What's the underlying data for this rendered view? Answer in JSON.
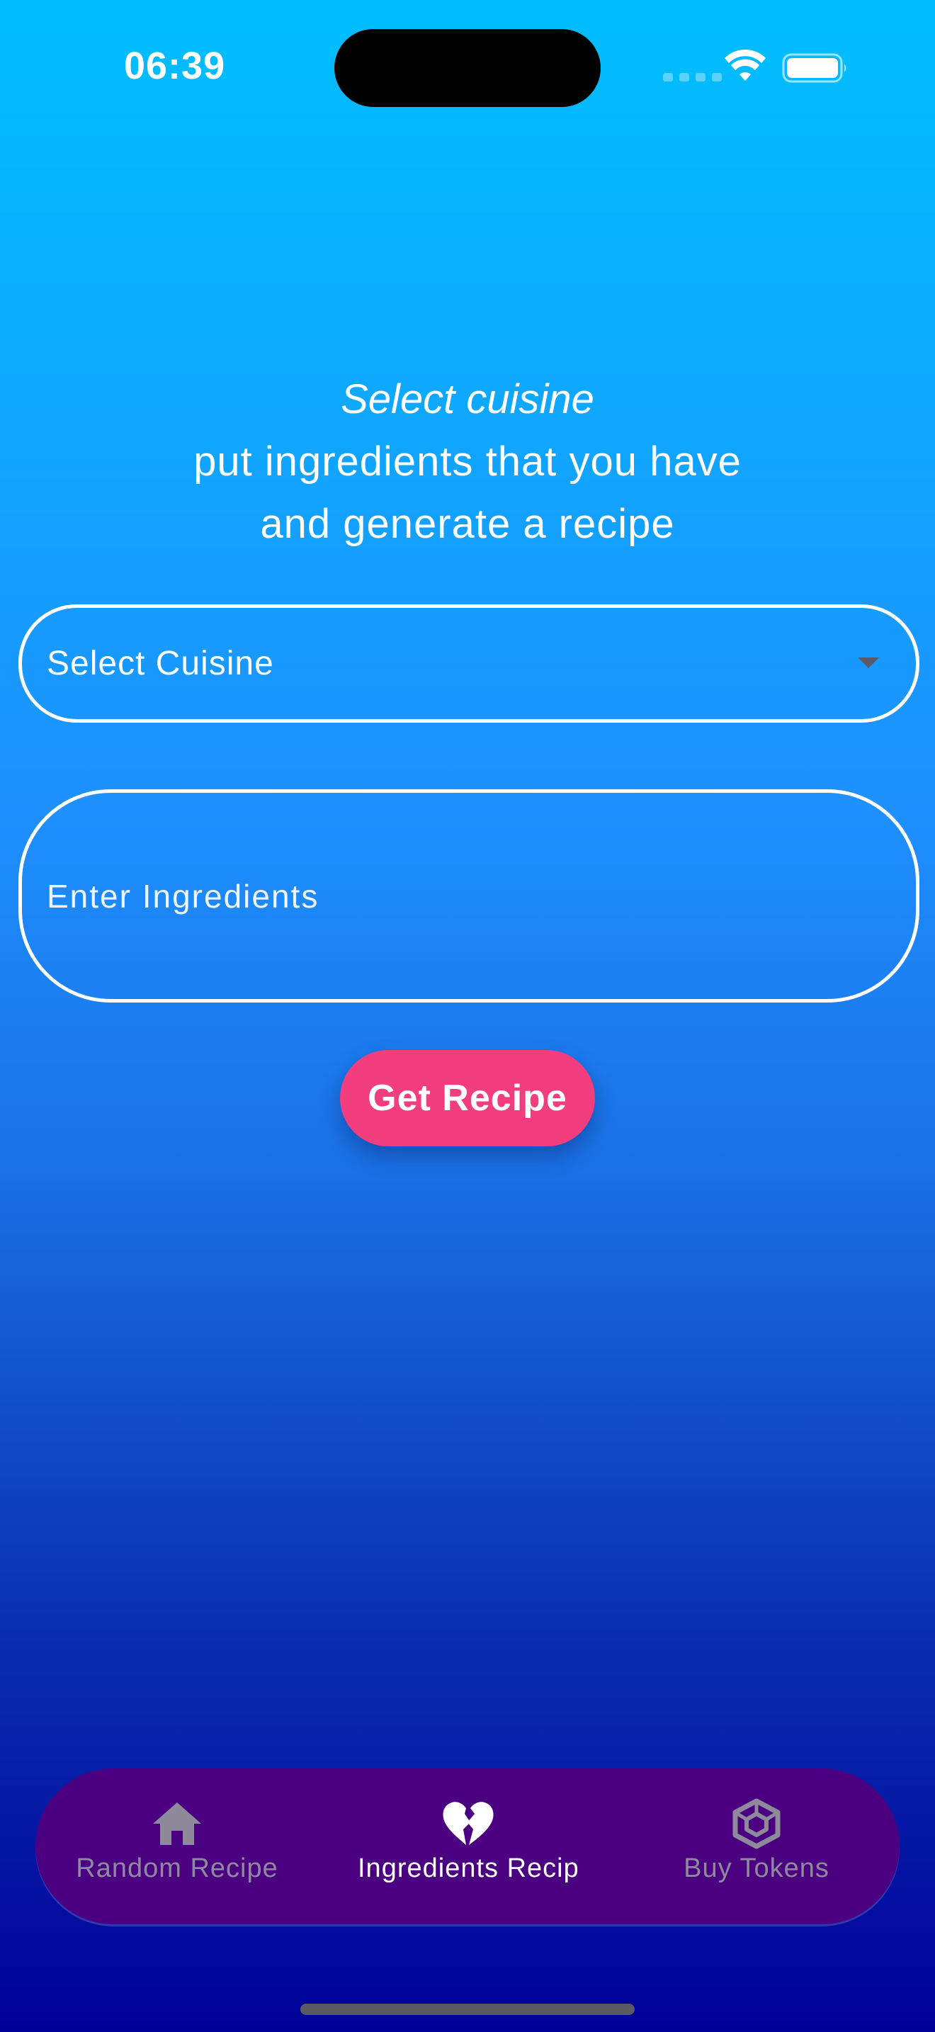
{
  "status_bar": {
    "time": "06:39"
  },
  "headline": {
    "line1": "Select cuisine",
    "line2": "put ingredients that you have",
    "line3": "and generate a recipe"
  },
  "cuisine_select": {
    "label": "Select Cuisine",
    "icon": "chevron-down-icon"
  },
  "ingredients_input": {
    "placeholder": "Enter Ingredients"
  },
  "get_recipe_button": {
    "label": "Get Recipe",
    "color": "#f23d7e"
  },
  "bottom_nav": {
    "background": "#4b0082",
    "items": [
      {
        "label": "Random Recipe",
        "icon": "home-icon",
        "active": false
      },
      {
        "label": "Ingredients Recipe",
        "icon": "broken-heart-icon",
        "active": true
      },
      {
        "label": "Buy Tokens",
        "icon": "cube-icon",
        "active": false
      }
    ]
  },
  "colors": {
    "gradient_top": "#00bfff",
    "gradient_mid": "#1e90ff",
    "gradient_bottom": "#000099",
    "inactive_nav": "#8e8a9c"
  }
}
